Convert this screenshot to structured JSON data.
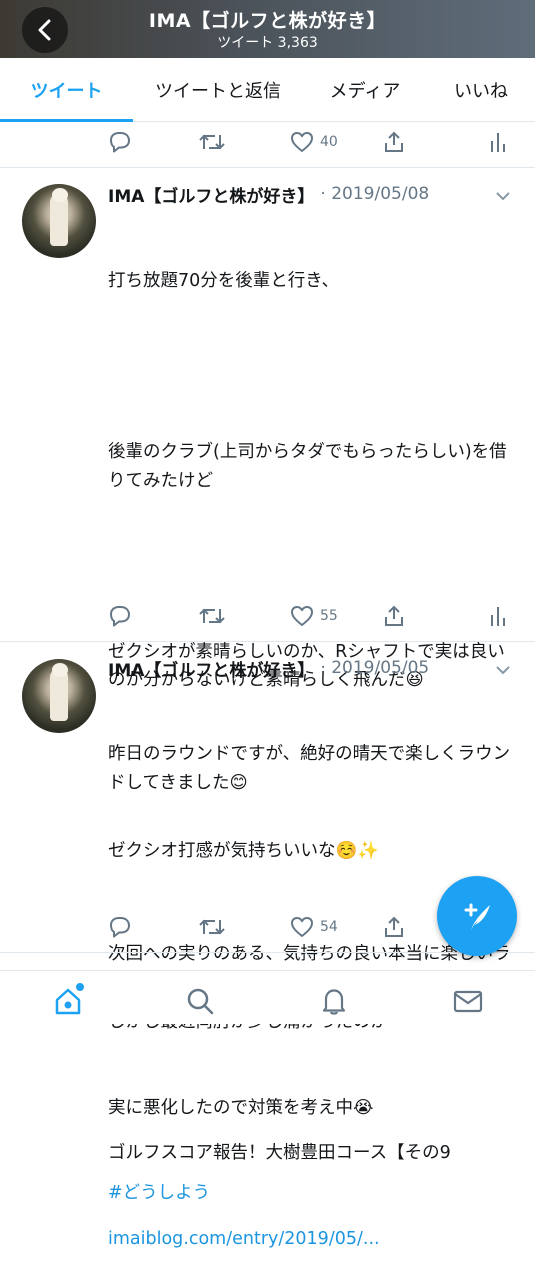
{
  "header": {
    "title": "IMA【ゴルフと株が好き】",
    "subtitle": "ツイート 3,363"
  },
  "tabs": [
    {
      "label": "ツイート",
      "active": true
    },
    {
      "label": "ツイートと返信",
      "active": false
    },
    {
      "label": "メディア",
      "active": false
    },
    {
      "label": "いいね",
      "active": false
    }
  ],
  "top_actions": {
    "like_count": "40"
  },
  "tweets": [
    {
      "name": "IMA【ゴルフと株が好き】",
      "date": "· 2019/05/08",
      "body_lines": [
        "打ち放題70分を後輩と行き、",
        "",
        "後輩のクラブ(上司からタダでもらったらしい)を借りてみたけど",
        "",
        "ゼクシオが素晴らしいのか、Rシャフトで実は良いのか分からないけど素晴らしく飛んだ😆",
        "",
        "ゼクシオ打感が気持ちいいな☺️✨",
        "",
        "しかし最近両肘が少し痛かったのが",
        "実に悪化したので対策を考え中😭"
      ],
      "hashtag": "#どうしよう",
      "like_count": "55"
    },
    {
      "name": "IMA【ゴルフと株が好き】",
      "date": "· 2019/05/05",
      "body_lines": [
        "昨日のラウンドですが、絶好の晴天で楽しくラウンドしてきました😊",
        "",
        "次回への実りのある、気持ちの良い本当に楽しいラウンドでした♪😆👍✨⛳",
        "",
        "ゴルフスコア報告！大樹豊田コース【その9"
      ],
      "link": "imaiblog.com/entry/2019/05/...",
      "like_count": "54"
    }
  ],
  "icons": {
    "back": "chevron-left-icon",
    "reply": "reply-icon",
    "retweet": "retweet-icon",
    "like": "heart-icon",
    "share": "share-icon",
    "analytics": "analytics-icon",
    "compose": "compose-tweet-icon",
    "home": "home-icon",
    "search": "search-icon",
    "notifications": "bell-icon",
    "messages": "mail-icon"
  },
  "colors": {
    "accent": "#1da1f2",
    "link": "#1b95e0",
    "muted": "#657786"
  }
}
